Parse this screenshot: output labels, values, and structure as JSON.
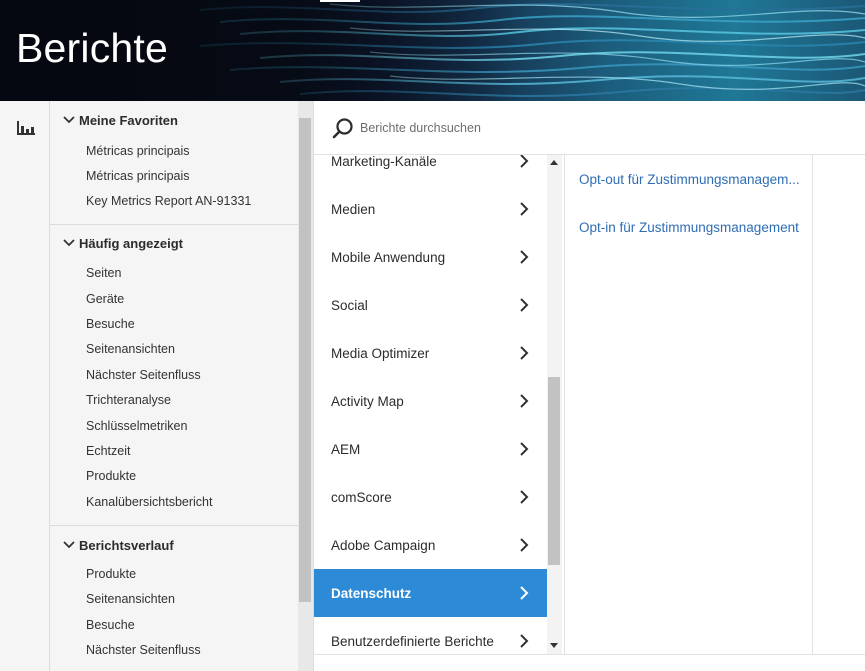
{
  "header": {
    "title": "Berichte"
  },
  "rail": {
    "icon": "reports-chart-icon"
  },
  "sidebar": {
    "sections": [
      {
        "title": "Meine Favoriten",
        "items": [
          "Métricas principais",
          "Métricas principais",
          "Key Metrics Report AN-91331"
        ]
      },
      {
        "title": "Häufig angezeigt",
        "items": [
          "Seiten",
          "Geräte",
          "Besuche",
          "Seitenansichten",
          "Nächster Seitenfluss",
          "Trichteranalyse",
          "Schlüsselmetriken",
          "Echtzeit",
          "Produkte",
          "Kanalübersichtsbericht"
        ]
      },
      {
        "title": "Berichtsverlauf",
        "items": [
          "Produkte",
          "Seitenansichten",
          "Besuche",
          "Nächster Seitenfluss"
        ]
      }
    ]
  },
  "search": {
    "placeholder": "Berichte durchsuchen"
  },
  "categories": [
    "Marketing-Kanäle",
    "Medien",
    "Mobile Anwendung",
    "Social",
    "Media Optimizer",
    "Activity Map",
    "AEM",
    "comScore",
    "Adobe Campaign",
    "Datenschutz",
    "Benutzerdefinierte Berichte"
  ],
  "active_category": "Datenschutz",
  "reports": [
    "Opt-out für Zustimmungsmanagem...",
    "Opt-in für Zustimmungsmanagement"
  ],
  "colors": {
    "accent": "#2d8ad6",
    "link": "#2f6db5"
  }
}
